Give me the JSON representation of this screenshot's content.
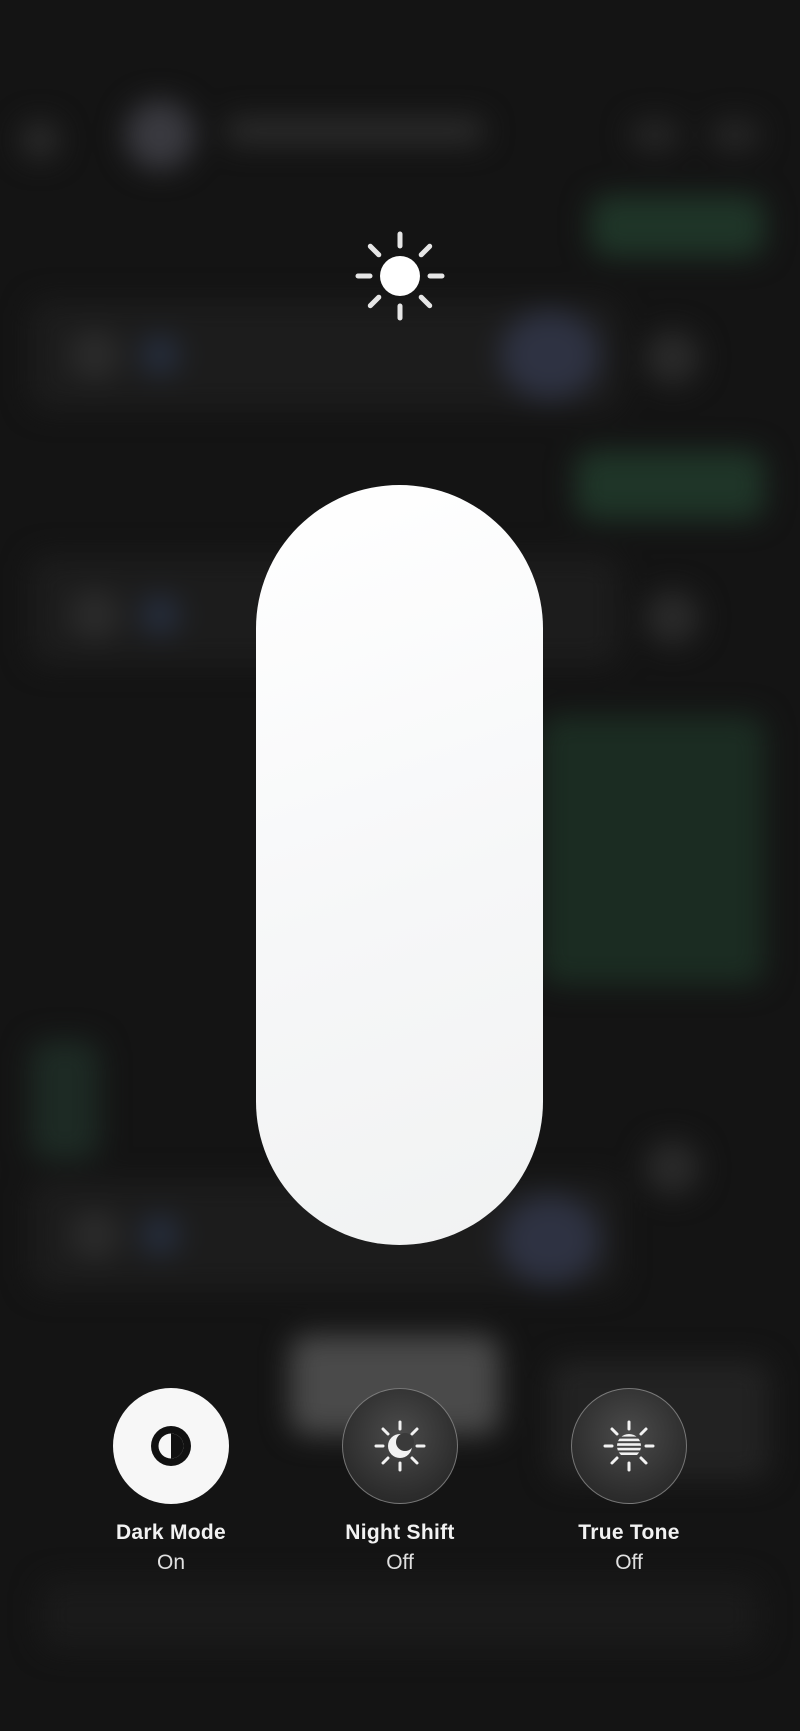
{
  "brightness": {
    "icon": "sun-icon",
    "level": 1.0
  },
  "controls": [
    {
      "label": "Dark Mode",
      "state": "On",
      "icon": "dark-mode-icon"
    },
    {
      "label": "Night Shift",
      "state": "Off",
      "icon": "night-shift-icon"
    },
    {
      "label": "True Tone",
      "state": "Off",
      "icon": "true-tone-icon"
    }
  ],
  "colors": {
    "background": "#141414",
    "slider_fill": "#f7f7f7",
    "button_on": "#f7f7f7",
    "button_off": "#333333"
  }
}
